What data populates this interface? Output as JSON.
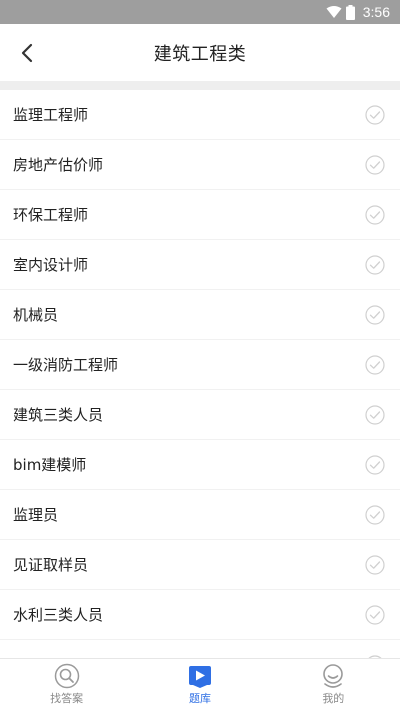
{
  "status_bar": {
    "time": "3:56"
  },
  "header": {
    "title": "建筑工程类"
  },
  "list": {
    "items": [
      {
        "label": "监理工程师"
      },
      {
        "label": "房地产估价师"
      },
      {
        "label": "环保工程师"
      },
      {
        "label": "室内设计师"
      },
      {
        "label": "机械员"
      },
      {
        "label": "一级消防工程师"
      },
      {
        "label": "建筑三类人员"
      },
      {
        "label": "bim建模师"
      },
      {
        "label": "监理员"
      },
      {
        "label": "见证取样员"
      },
      {
        "label": "水利三类人员"
      },
      {
        "label": ""
      }
    ]
  },
  "tabbar": {
    "tabs": [
      {
        "label": "找答案",
        "icon": "search-icon",
        "active": false
      },
      {
        "label": "题库",
        "icon": "question-bank-icon",
        "active": true
      },
      {
        "label": "我的",
        "icon": "profile-icon",
        "active": false
      }
    ]
  },
  "colors": {
    "accent": "#2f6fe4",
    "status_bar": "#9e9e9e",
    "check": "#d0d0d0"
  }
}
